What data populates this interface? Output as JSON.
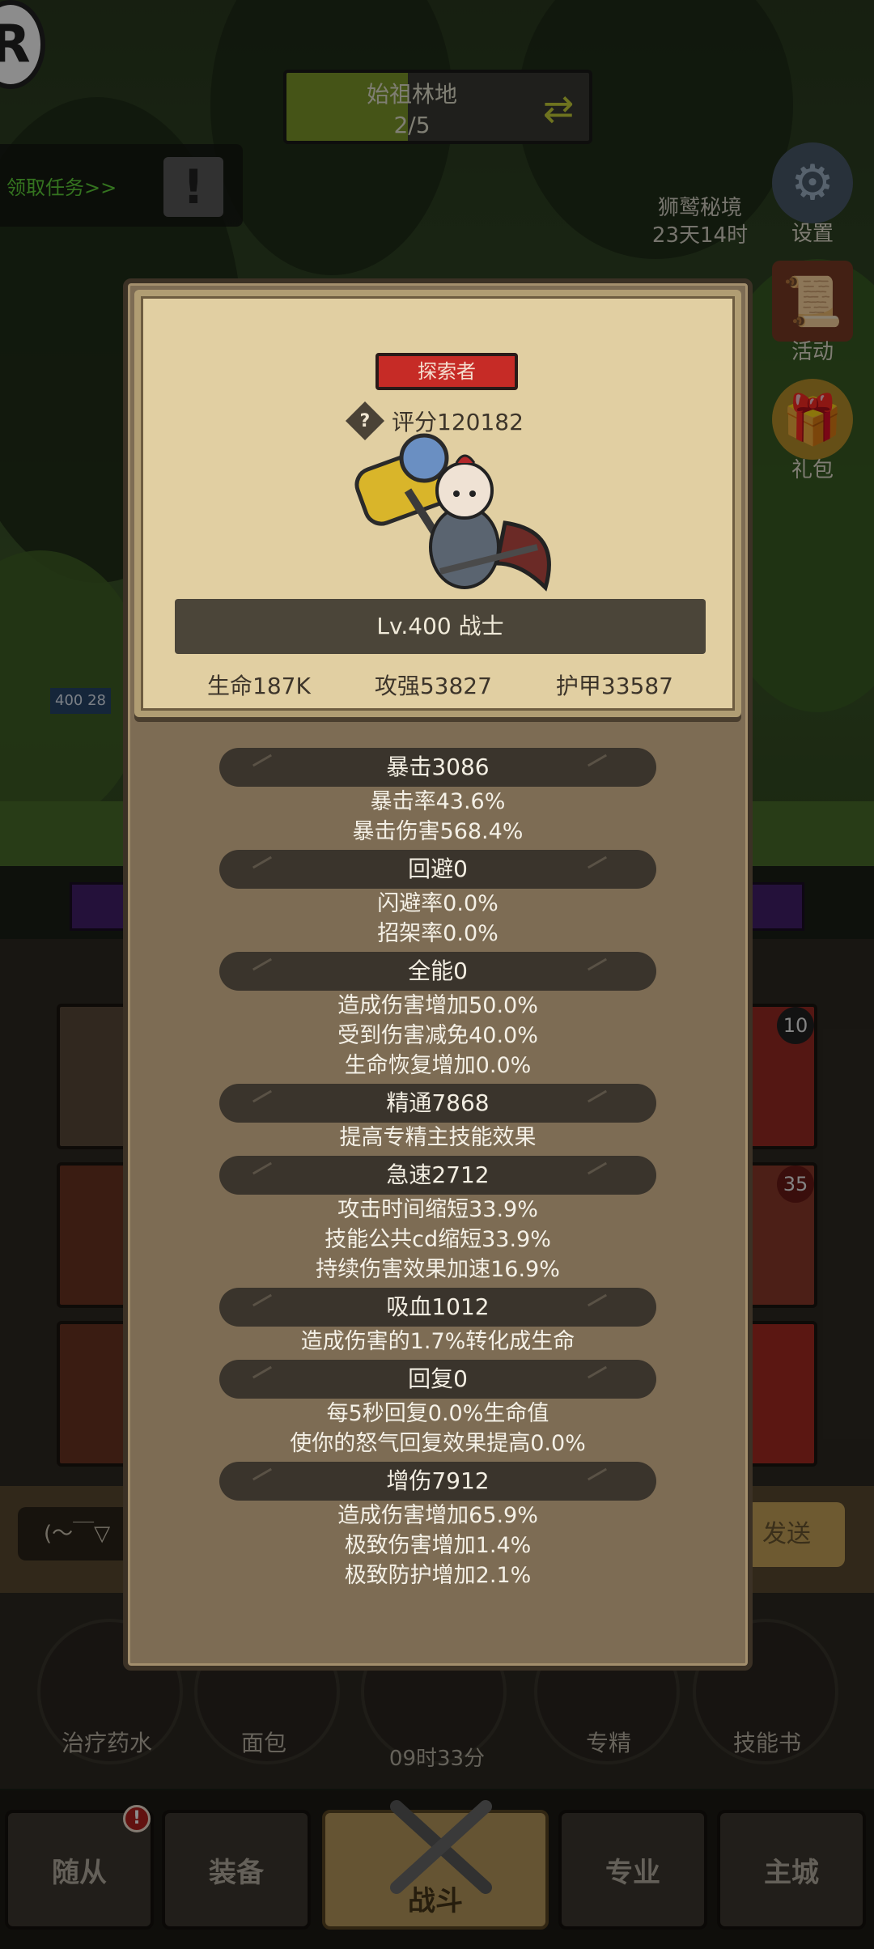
{
  "scene": {
    "stage_name": "始祖林地",
    "stage_progress": "2/5",
    "stage_fill_fraction": 0.4,
    "quest_text": "领取任务>>",
    "quest_alert": "!",
    "eagle_label_line1": "狮鹫秘境",
    "eagle_label_line2": "23天14时",
    "settings_label": "设置",
    "activity_label": "活动",
    "gift_label": "礼包",
    "unit_level": "400",
    "unit_hp": "28"
  },
  "lower": {
    "slot_badge_1": "10",
    "slot_badge_2": "35",
    "chat_placeholder": "(～￣▽",
    "send_label": "发送",
    "items": [
      "治疗药水",
      "面包",
      "专精",
      "技能书"
    ],
    "timer": "09时33分"
  },
  "nav": {
    "tabs": [
      "随从",
      "装备",
      "战斗",
      "专业",
      "主城"
    ],
    "badge": "!"
  },
  "popup": {
    "title_tag": "探索者",
    "score": "评分120182",
    "help_icon_label": "?",
    "level_class": "Lv.400 战士",
    "stats": {
      "hp": "生命187K",
      "attack": "攻强53827",
      "armor": "护甲33587"
    },
    "groups": [
      {
        "header": "暴击3086",
        "lines": [
          "暴击率43.6%",
          "暴击伤害568.4%"
        ]
      },
      {
        "header": "回避0",
        "lines": [
          "闪避率0.0%",
          "招架率0.0%"
        ]
      },
      {
        "header": "全能0",
        "lines": [
          "造成伤害增加50.0%",
          "受到伤害减免40.0%",
          "生命恢复增加0.0%"
        ]
      },
      {
        "header": "精通7868",
        "lines": [
          "提高专精主技能效果"
        ]
      },
      {
        "header": "急速2712",
        "lines": [
          "攻击时间缩短33.9%",
          "技能公共cd缩短33.9%",
          "持续伤害效果加速16.9%"
        ]
      },
      {
        "header": "吸血1012",
        "lines": [
          "造成伤害的1.7%转化成生命"
        ]
      },
      {
        "header": "回复0",
        "lines": [
          "每5秒回复0.0%生命值",
          "使你的怒气回复效果提高0.0%"
        ]
      },
      {
        "header": "增伤7912",
        "lines": [
          "造成伤害增加65.9%",
          "极致伤害增加1.4%",
          "极致防护增加2.1%"
        ]
      }
    ]
  },
  "colors": {
    "title_tag_red": "#c62b26",
    "stage_fill_green": "#7f9a2a",
    "quest_green": "#5fd23a",
    "card_parchment": "#e1cfa2",
    "popup_panel": "#7d6c54"
  }
}
